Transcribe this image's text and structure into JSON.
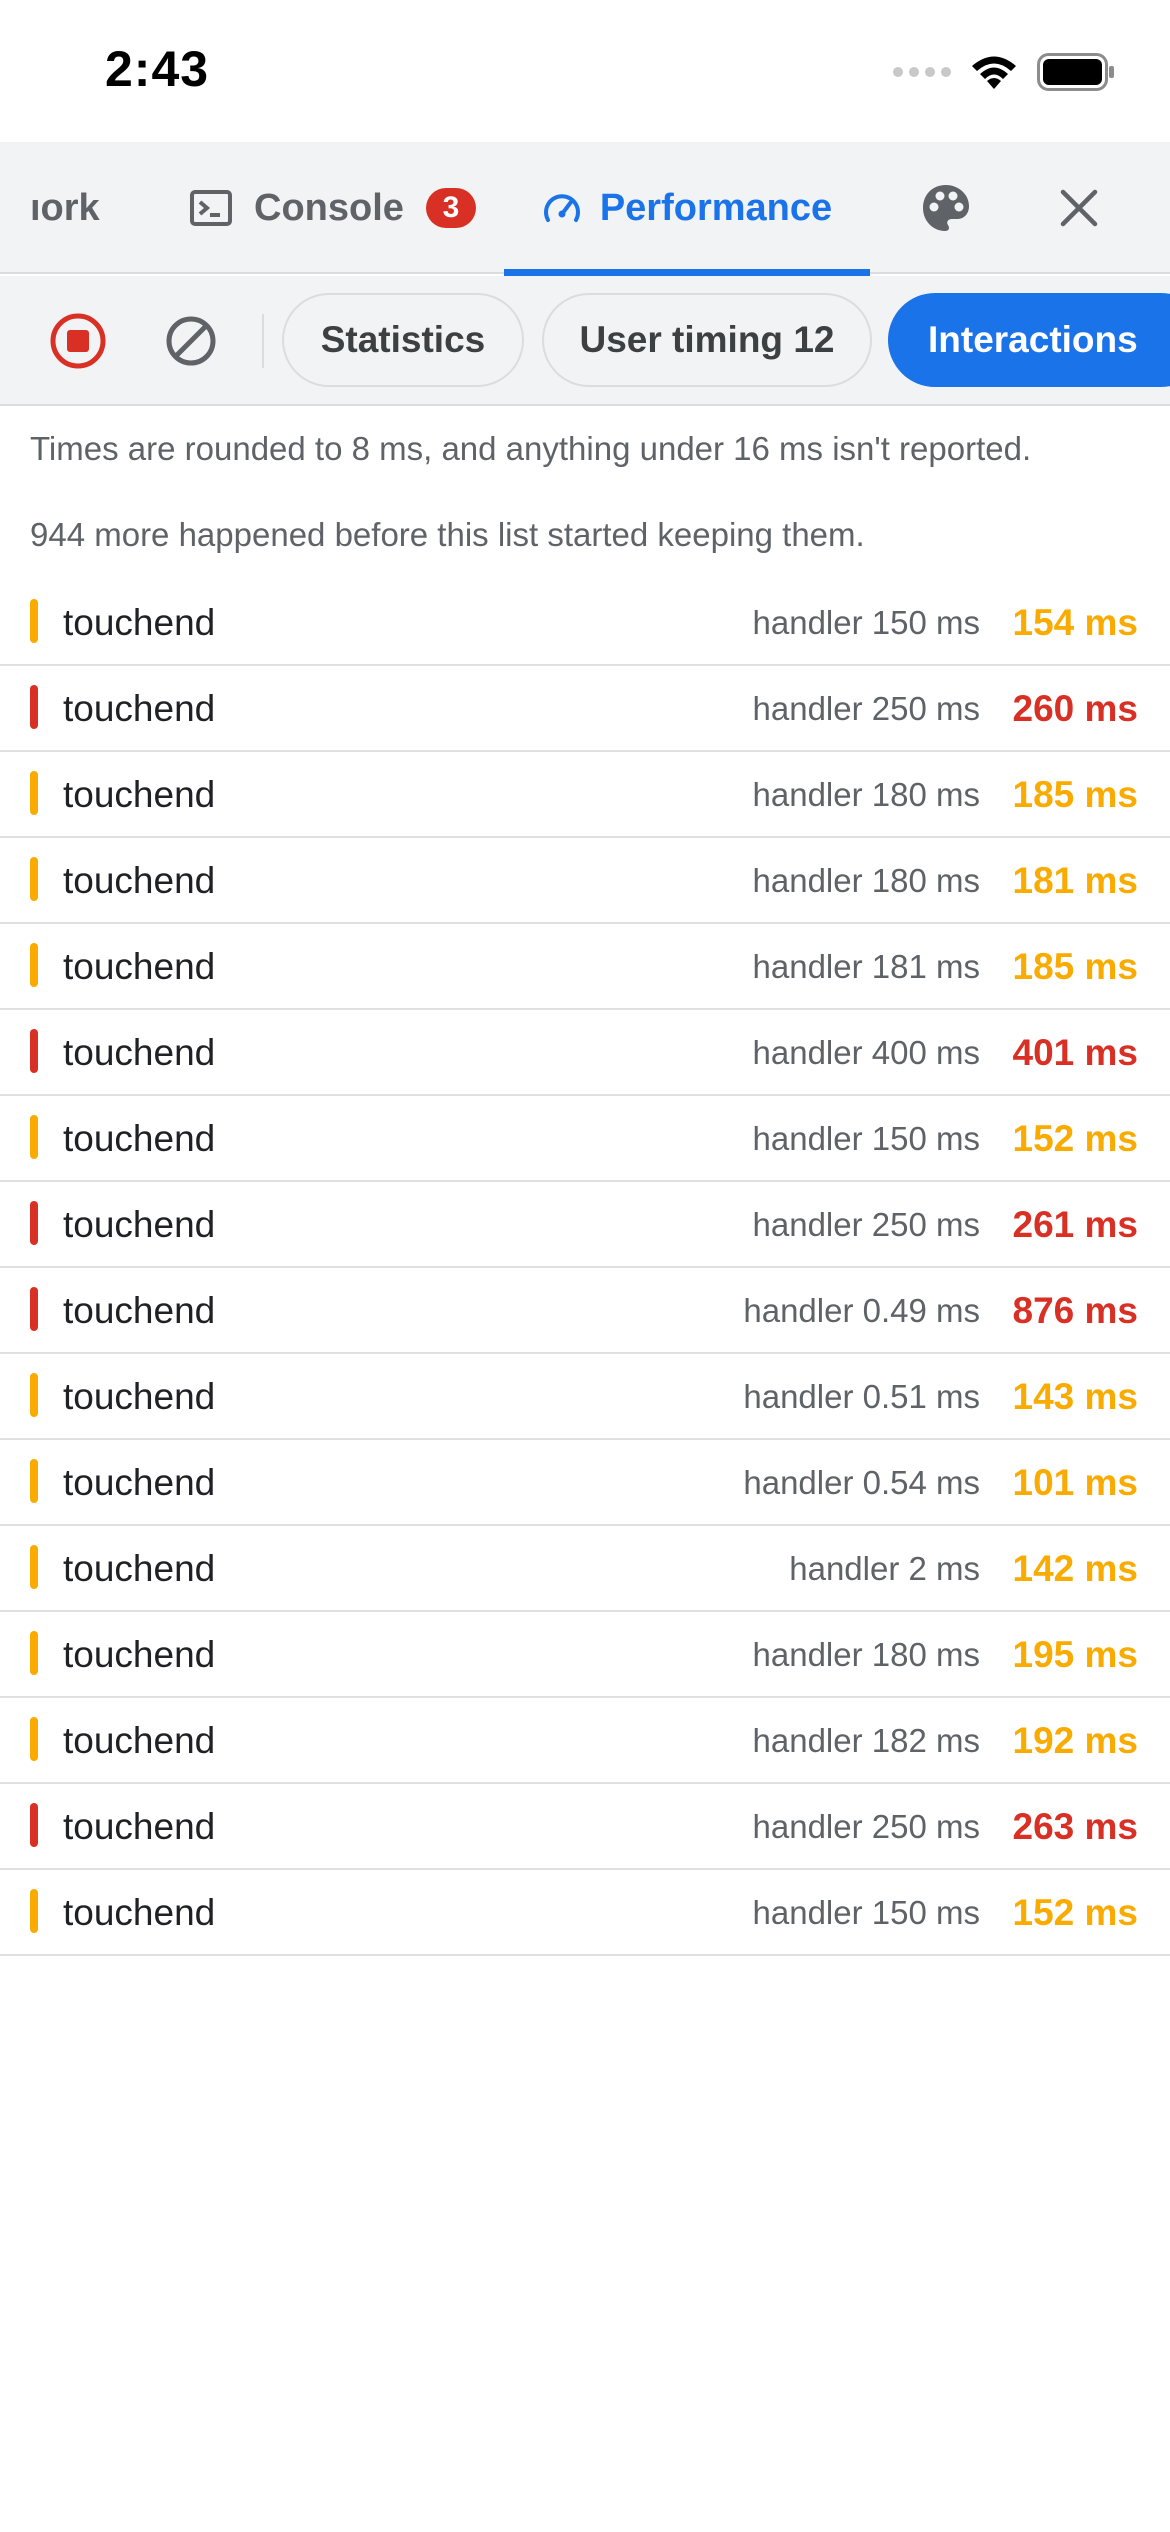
{
  "status_bar": {
    "time": "2:43"
  },
  "tabs": {
    "network_label": "ıork",
    "console_label": "Console",
    "console_badge": "3",
    "performance_label": "Performance"
  },
  "toolbar": {
    "statistics_label": "Statistics",
    "user_timing_label": "User timing 12",
    "interactions_label": "Interactions"
  },
  "notes": {
    "rounding": "Times are rounded to 8 ms, and anything under 16 ms isn't reported.",
    "dropped": "944 more happened before this list started keeping them."
  },
  "colors": {
    "accent": "#1a73e8",
    "warning": "#f9ab00",
    "error": "#d93025"
  },
  "icons": {
    "console": "terminal-icon",
    "performance": "gauge-icon",
    "palette": "palette-icon",
    "close": "close-icon",
    "record": "record-stop-icon",
    "clear": "clear-icon"
  },
  "events": [
    {
      "name": "touchend",
      "handler": "handler 150 ms",
      "total": "154 ms",
      "severity": "warning"
    },
    {
      "name": "touchend",
      "handler": "handler 250 ms",
      "total": "260 ms",
      "severity": "error"
    },
    {
      "name": "touchend",
      "handler": "handler 180 ms",
      "total": "185 ms",
      "severity": "warning"
    },
    {
      "name": "touchend",
      "handler": "handler 180 ms",
      "total": "181 ms",
      "severity": "warning"
    },
    {
      "name": "touchend",
      "handler": "handler 181 ms",
      "total": "185 ms",
      "severity": "warning"
    },
    {
      "name": "touchend",
      "handler": "handler 400 ms",
      "total": "401 ms",
      "severity": "error"
    },
    {
      "name": "touchend",
      "handler": "handler 150 ms",
      "total": "152 ms",
      "severity": "warning"
    },
    {
      "name": "touchend",
      "handler": "handler 250 ms",
      "total": "261 ms",
      "severity": "error"
    },
    {
      "name": "touchend",
      "handler": "handler 0.49 ms",
      "total": "876 ms",
      "severity": "error"
    },
    {
      "name": "touchend",
      "handler": "handler 0.51 ms",
      "total": "143 ms",
      "severity": "warning"
    },
    {
      "name": "touchend",
      "handler": "handler 0.54 ms",
      "total": "101 ms",
      "severity": "warning"
    },
    {
      "name": "touchend",
      "handler": "handler 2 ms",
      "total": "142 ms",
      "severity": "warning"
    },
    {
      "name": "touchend",
      "handler": "handler 180 ms",
      "total": "195 ms",
      "severity": "warning"
    },
    {
      "name": "touchend",
      "handler": "handler 182 ms",
      "total": "192 ms",
      "severity": "warning"
    },
    {
      "name": "touchend",
      "handler": "handler 250 ms",
      "total": "263 ms",
      "severity": "error"
    },
    {
      "name": "touchend",
      "handler": "handler 150 ms",
      "total": "152 ms",
      "severity": "warning"
    }
  ]
}
